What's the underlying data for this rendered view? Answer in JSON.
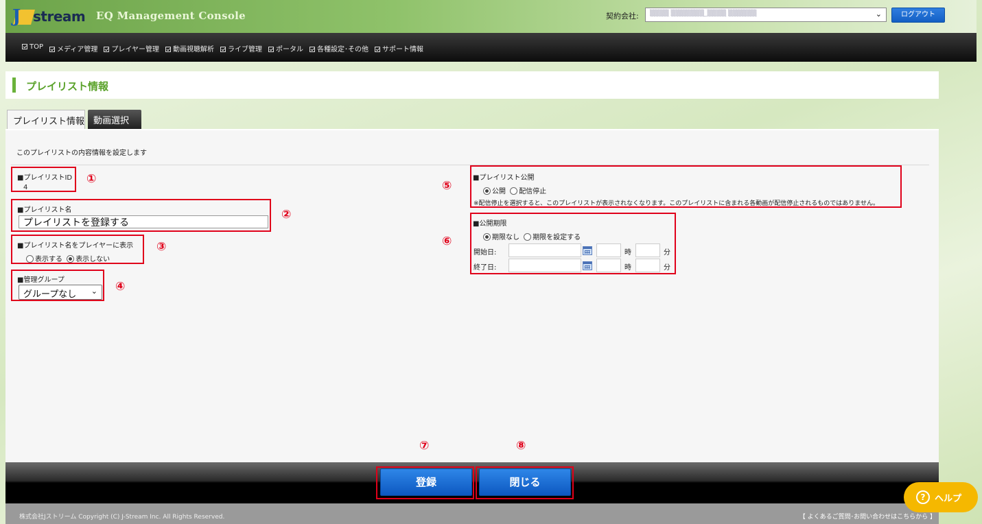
{
  "header": {
    "logo_text": "stream",
    "logo_letter": "J",
    "app_title": "EQ Management Console",
    "company_label": "契約会社:",
    "company_select_value": "▒▒▒▒  ▒▒▒▒▒▒▒_▒▒▒▒ ▒▒▒▒▒▒",
    "logout_label": "ログアウト"
  },
  "nav": {
    "items": [
      "TOP",
      "メディア管理",
      "プレイヤー管理",
      "動画視聴解析",
      "ライブ管理",
      "ポータル",
      "各種設定･その他",
      "サポート情報"
    ]
  },
  "page": {
    "title": "プレイリスト情報"
  },
  "tabs": {
    "info": "プレイリスト情報",
    "video": "動画選択"
  },
  "form": {
    "intro": "このプレイリストの内容情報を設定します",
    "playlist_id_label": "■プレイリストID",
    "playlist_id_value": "4",
    "playlist_name_label": "■プレイリスト名",
    "playlist_name_value": "プレイリストを登録する",
    "show_name_label": "■プレイリスト名をプレイヤーに表示",
    "show_opt_yes": "表示する",
    "show_opt_no": "表示しない",
    "group_label": "■管理グループ",
    "group_value": "グループなし",
    "publish_label": "■プレイリスト公開",
    "publish_opt_on": "公開",
    "publish_opt_off": "配信停止",
    "publish_note": "※配信停止を選択すると、このプレイリストが表示されなくなります。このプレイリストに含まれる各動画が配信停止されるものではありません。",
    "period_label": "■公開期限",
    "period_opt_none": "期限なし",
    "period_opt_set": "期限を設定する",
    "start_label": "開始日:",
    "end_label": "終了日:",
    "hour_unit": "時",
    "minute_unit": "分"
  },
  "annotations": [
    "①",
    "②",
    "③",
    "④",
    "⑤",
    "⑥",
    "⑦",
    "⑧"
  ],
  "actions": {
    "register": "登録",
    "close": "閉じる"
  },
  "footer": {
    "copyright": "株式会社Jストリーム  Copyright (C) J-Stream Inc. All Rights Reserved.",
    "faq": "【 よくあるご質問･お問い合わせはこちらから 】"
  },
  "help": {
    "icon": "?",
    "label": "ヘルプ"
  },
  "colors": {
    "accent_green": "#5aa22a",
    "button_blue": "#1a6fd6",
    "annotation_red": "#e0001a",
    "help_yellow": "#f5b800"
  }
}
